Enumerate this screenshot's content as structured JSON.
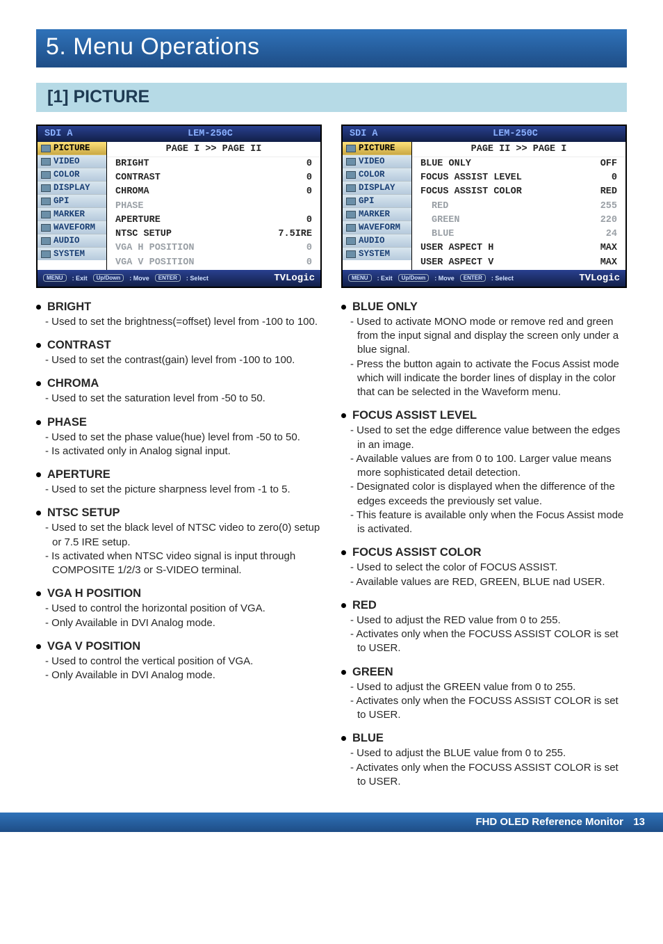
{
  "chapter": "5. Menu Operations",
  "section": "[1] PICTURE",
  "osd1": {
    "titleLeft": "SDI A",
    "titleMid": "LEM-250C",
    "side": [
      "PICTURE",
      "VIDEO",
      "COLOR",
      "DISPLAY",
      "GPI",
      "MARKER",
      "WAVEFORM",
      "AUDIO",
      "SYSTEM"
    ],
    "page": "PAGE I >> PAGE II",
    "rows": [
      {
        "l": "BRIGHT",
        "r": "0"
      },
      {
        "l": "CONTRAST",
        "r": "0"
      },
      {
        "l": "CHROMA",
        "r": "0"
      },
      {
        "l": "PHASE",
        "r": "",
        "dim": true
      },
      {
        "l": "APERTURE",
        "r": "0"
      },
      {
        "l": "NTSC SETUP",
        "r": "7.5IRE"
      },
      {
        "l": "VGA H POSITION",
        "r": "0",
        "dim": true
      },
      {
        "l": "VGA V POSITION",
        "r": "0",
        "dim": true
      }
    ],
    "foot": {
      "k1": "MENU",
      "t1": ": Exit",
      "k2": "Up/Down",
      "t2": ": Move",
      "k3": "ENTER",
      "t3": ": Select",
      "logo": "TVLogic"
    }
  },
  "osd2": {
    "titleLeft": "SDI A",
    "titleMid": "LEM-250C",
    "side": [
      "PICTURE",
      "VIDEO",
      "COLOR",
      "DISPLAY",
      "GPI",
      "MARKER",
      "WAVEFORM",
      "AUDIO",
      "SYSTEM"
    ],
    "page": "PAGE II >> PAGE I",
    "rows": [
      {
        "l": "BLUE ONLY",
        "r": "OFF"
      },
      {
        "l": "FOCUS ASSIST LEVEL",
        "r": "0"
      },
      {
        "l": "FOCUS ASSIST COLOR",
        "r": "RED"
      },
      {
        "l": "RED",
        "r": "255",
        "dim": true,
        "ind": true
      },
      {
        "l": "GREEN",
        "r": "220",
        "dim": true,
        "ind": true
      },
      {
        "l": "BLUE",
        "r": "24",
        "dim": true,
        "ind": true
      },
      {
        "l": "USER ASPECT H",
        "r": "MAX"
      },
      {
        "l": "USER ASPECT V",
        "r": "MAX"
      }
    ],
    "foot": {
      "k1": "MENU",
      "t1": ": Exit",
      "k2": "Up/Down",
      "t2": ": Move",
      "k3": "ENTER",
      "t3": ": Select",
      "logo": "TVLogic"
    }
  },
  "left": [
    {
      "h": "BRIGHT",
      "lines": [
        "Used to set the brightness(=offset) level from -100 to 100."
      ]
    },
    {
      "h": "CONTRAST",
      "lines": [
        "Used to set the contrast(gain) level from -100 to 100."
      ]
    },
    {
      "h": "CHROMA",
      "lines": [
        "Used to set the saturation level from -50 to 50."
      ]
    },
    {
      "h": "PHASE",
      "lines": [
        "Used to set the phase value(hue) level from -50 to 50.",
        "Is activated only in Analog signal input."
      ]
    },
    {
      "h": "APERTURE",
      "lines": [
        "Used to set the picture sharpness level from -1 to 5."
      ]
    },
    {
      "h": "NTSC SETUP",
      "lines": [
        "Used to set the black level of NTSC video to zero(0) setup or 7.5 IRE setup.",
        "Is activated when NTSC video signal is input through COMPOSITE 1/2/3 or S-VIDEO terminal."
      ]
    },
    {
      "h": "VGA H POSITION",
      "lines": [
        "Used to control the horizontal position of VGA.",
        "Only Available in DVI Analog mode."
      ]
    },
    {
      "h": "VGA V POSITION",
      "lines": [
        "Used to control the vertical position of VGA.",
        "Only Available in DVI Analog mode."
      ]
    }
  ],
  "right": [
    {
      "h": "BLUE ONLY",
      "lines": [
        "Used to activate MONO mode or remove red and green from the input signal and display the screen only under a blue signal.",
        "Press the button again to activate the Focus Assist mode which will indicate the border lines of display in the color that can be selected in the Waveform menu."
      ]
    },
    {
      "h": "FOCUS ASSIST LEVEL",
      "lines": [
        "Used to set the edge difference value between the edges in an image.",
        "Available values are from 0 to 100. Larger value means more sophisticated detail detection.",
        "Designated color is displayed when the difference of the edges exceeds the previously set value.",
        "This feature is available only when the Focus Assist mode is activated."
      ]
    },
    {
      "h": "FOCUS ASSIST COLOR",
      "lines": [
        "Used to select the color of FOCUS ASSIST.",
        "Available values are RED, GREEN, BLUE nad USER."
      ]
    },
    {
      "h": "RED",
      "lines": [
        "Used to adjust the RED value from 0 to 255.",
        "Activates only when the FOCUSS ASSIST COLOR is set to USER."
      ]
    },
    {
      "h": "GREEN",
      "lines": [
        "Used to adjust the GREEN value from 0 to 255.",
        "Activates only when the FOCUSS ASSIST COLOR is set to USER."
      ]
    },
    {
      "h": "BLUE",
      "lines": [
        "Used to adjust the BLUE value from 0 to 255.",
        "Activates only when the FOCUSS ASSIST COLOR is set to USER."
      ]
    }
  ],
  "footer": {
    "text": "FHD OLED Reference Monitor",
    "page": "13"
  }
}
